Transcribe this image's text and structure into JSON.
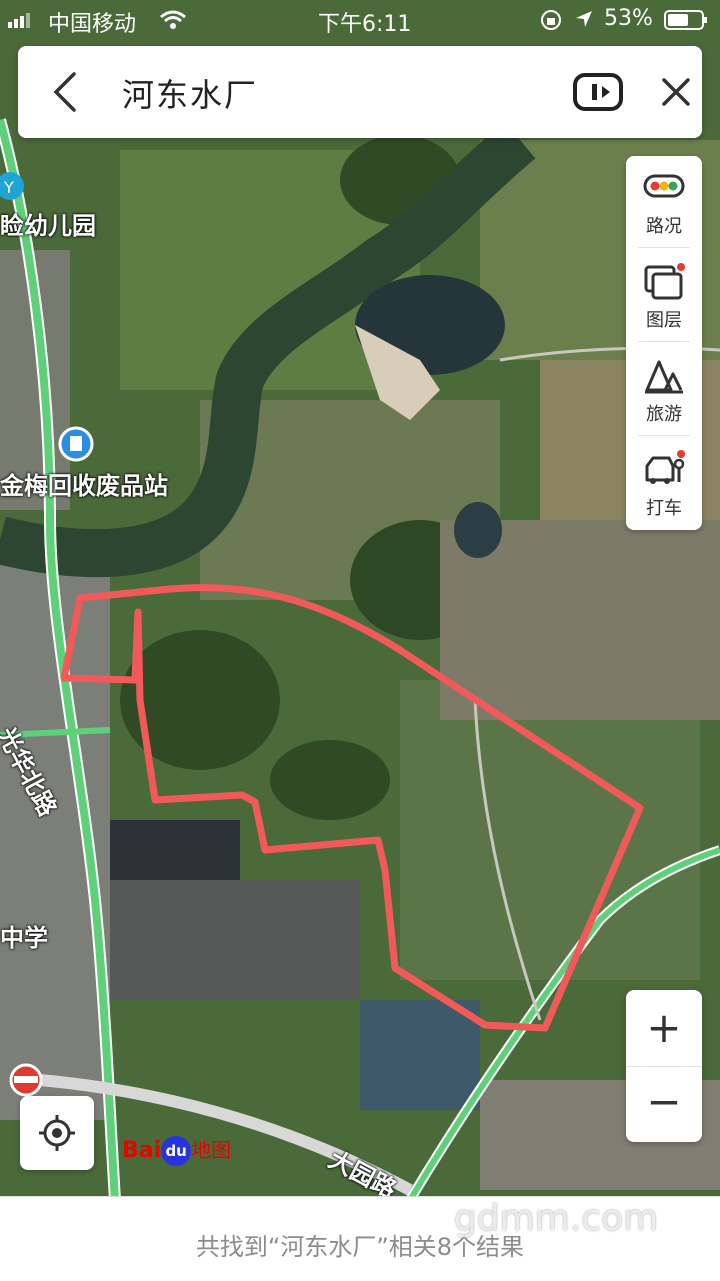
{
  "status_bar": {
    "carrier": "中国移动",
    "time": "下午6:11",
    "battery": "53%"
  },
  "search": {
    "query": "河东水厂"
  },
  "tools": [
    {
      "label": "路况",
      "icon": "traffic-light-icon"
    },
    {
      "label": "图层",
      "icon": "layers-icon"
    },
    {
      "label": "旅游",
      "icon": "tourism-icon"
    },
    {
      "label": "打车",
      "icon": "taxi-icon"
    }
  ],
  "map_labels": {
    "kindergarten": "睑幼儿园",
    "recycling": "金梅回收废品站",
    "road_guanghua": "光华北路",
    "school": "中学",
    "road_dayuan": "大园路"
  },
  "logo": {
    "brand": "Bai",
    "paw": "du",
    "suffix": "地图"
  },
  "result": {
    "text": "共找到“河东水厂”相关8个结果"
  },
  "watermark": "gdmm.com",
  "colors": {
    "boundary": "#f25a5a",
    "road": "#5fd07a",
    "card": "#ffffff"
  }
}
